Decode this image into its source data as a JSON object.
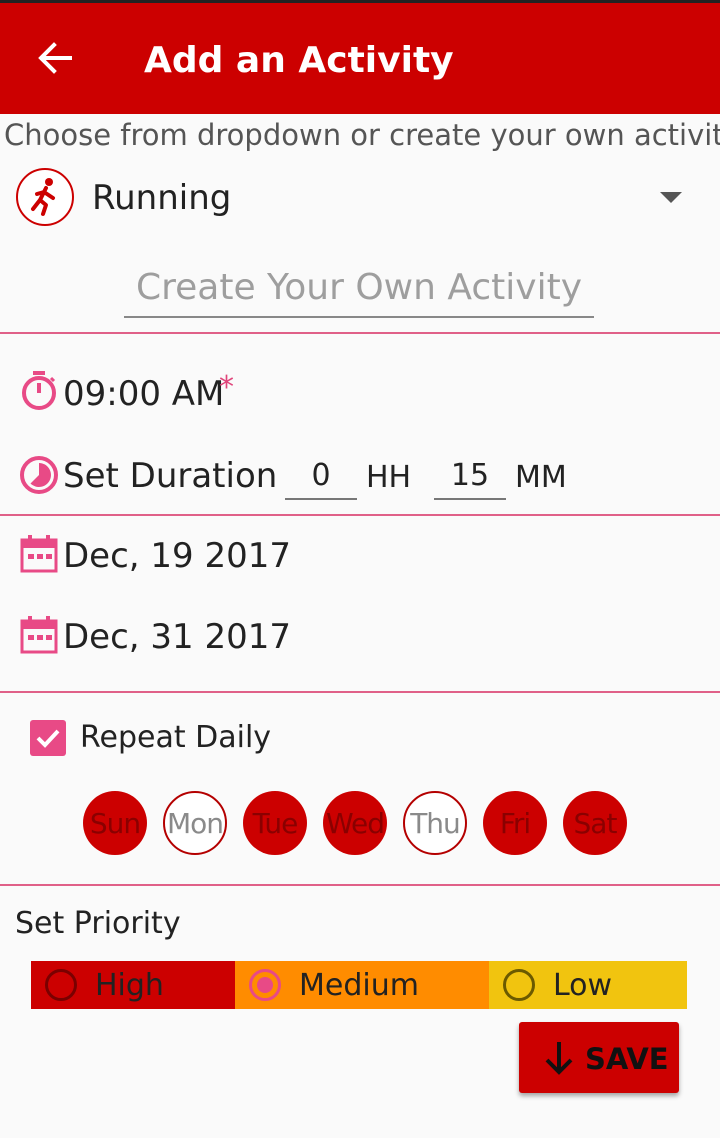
{
  "appbar": {
    "title": "Add an Activity",
    "back_icon": "arrow-left-icon"
  },
  "activity": {
    "hint": "Choose from dropdown or create your own activity",
    "selected": "Running",
    "icon": "running-icon",
    "custom_placeholder": "Create Your Own Activity"
  },
  "time": {
    "value": "09:00 AM",
    "required_mark": "*",
    "icon": "timer-icon"
  },
  "duration": {
    "label": "Set Duration",
    "hours": "0",
    "hours_unit": "HH",
    "minutes": "15",
    "minutes_unit": "MM",
    "icon": "pie-timer-icon"
  },
  "dates": {
    "start": "Dec, 19 2017",
    "end": "Dec, 31 2017",
    "icon": "calendar-icon"
  },
  "repeat": {
    "label": "Repeat Daily",
    "checked": true,
    "days": [
      {
        "label": "Sun",
        "selected": true
      },
      {
        "label": "Mon",
        "selected": false
      },
      {
        "label": "Tue",
        "selected": true
      },
      {
        "label": "Wed",
        "selected": true
      },
      {
        "label": "Thu",
        "selected": false
      },
      {
        "label": "Fri",
        "selected": true
      },
      {
        "label": "Sat",
        "selected": true
      }
    ]
  },
  "priority": {
    "title": "Set Priority",
    "options": [
      {
        "label": "High",
        "color": "#cc0000"
      },
      {
        "label": "Medium",
        "color": "#ff8c00"
      },
      {
        "label": "Low",
        "color": "#f1c40f"
      }
    ],
    "selected": "Medium"
  },
  "save": {
    "label": "SAVE",
    "icon": "arrow-down-icon"
  },
  "colors": {
    "primary": "#cc0000",
    "accent": "#e84a86"
  }
}
